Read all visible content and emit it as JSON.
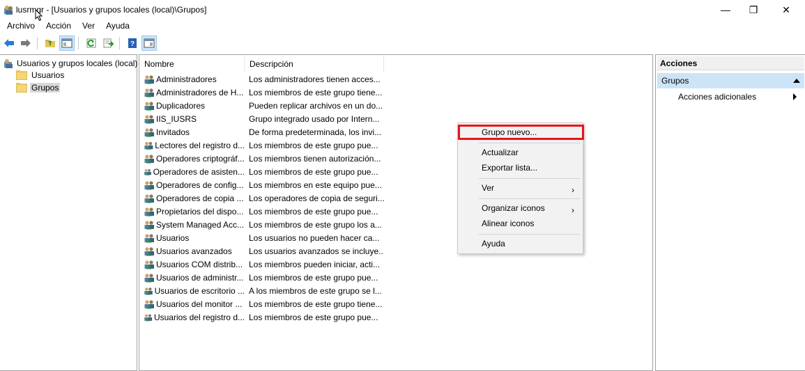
{
  "window": {
    "title": "lusrmgr - [Usuarios y grupos locales (local)\\Grupos]",
    "minimize": "—",
    "maximize": "❐",
    "close": "✕"
  },
  "menubar": {
    "items": [
      "Archivo",
      "Acción",
      "Ver",
      "Ayuda"
    ]
  },
  "toolbar": {
    "buttons": [
      "back-arrow-icon",
      "forward-arrow-icon",
      "up-folder-icon",
      "show-hide-tree-icon",
      "refresh-icon",
      "export-list-icon",
      "help-icon",
      "show-hide-action-pane-icon"
    ]
  },
  "tree": {
    "root": "Usuarios y grupos locales (local)",
    "children": [
      {
        "label": "Usuarios",
        "selected": false
      },
      {
        "label": "Grupos",
        "selected": true
      }
    ]
  },
  "list": {
    "columns": [
      "Nombre",
      "Descripción"
    ],
    "rows": [
      {
        "name": "Administradores",
        "desc": "Los administradores tienen acces..."
      },
      {
        "name": "Administradores de H...",
        "desc": "Los miembros de este grupo tiene..."
      },
      {
        "name": "Duplicadores",
        "desc": "Pueden replicar archivos en un do..."
      },
      {
        "name": "IIS_IUSRS",
        "desc": "Grupo integrado usado por Intern..."
      },
      {
        "name": "Invitados",
        "desc": "De forma predeterminada, los invi..."
      },
      {
        "name": "Lectores del registro d...",
        "desc": "Los miembros de este grupo pue..."
      },
      {
        "name": "Operadores criptográf...",
        "desc": "Los miembros tienen autorización..."
      },
      {
        "name": "Operadores de asisten...",
        "desc": "Los miembros de este grupo pue..."
      },
      {
        "name": "Operadores de config...",
        "desc": "Los miembros en este equipo pue..."
      },
      {
        "name": "Operadores de copia ...",
        "desc": "Los operadores de copia de seguri..."
      },
      {
        "name": "Propietarios del dispo...",
        "desc": "Los miembros de este grupo pue..."
      },
      {
        "name": "System Managed Acc...",
        "desc": "Los miembros de este grupo los a..."
      },
      {
        "name": "Usuarios",
        "desc": "Los usuarios no pueden hacer ca..."
      },
      {
        "name": "Usuarios avanzados",
        "desc": "Los usuarios avanzados se incluye..."
      },
      {
        "name": "Usuarios COM distrib...",
        "desc": "Los miembros pueden iniciar, acti..."
      },
      {
        "name": "Usuarios de administr...",
        "desc": "Los miembros de este grupo pue..."
      },
      {
        "name": "Usuarios de escritorio ...",
        "desc": "A los miembros de este grupo se l..."
      },
      {
        "name": "Usuarios del monitor ...",
        "desc": "Los miembros de este grupo tiene..."
      },
      {
        "name": "Usuarios del registro d...",
        "desc": "Los miembros de este grupo pue..."
      }
    ]
  },
  "actions": {
    "header": "Acciones",
    "group": "Grupos",
    "more": "Acciones adicionales"
  },
  "context_menu": {
    "items": [
      {
        "label": "Grupo nuevo...",
        "submenu": false,
        "highlighted": true
      },
      {
        "label": "Actualizar",
        "submenu": false
      },
      {
        "label": "Exportar lista...",
        "submenu": false
      },
      {
        "label": "Ver",
        "submenu": true
      },
      {
        "label": "Organizar iconos",
        "submenu": true
      },
      {
        "label": "Alinear iconos",
        "submenu": false
      },
      {
        "label": "Ayuda",
        "submenu": false
      }
    ],
    "submenu_arrow": "›",
    "highlight_color": "#e8131a"
  }
}
